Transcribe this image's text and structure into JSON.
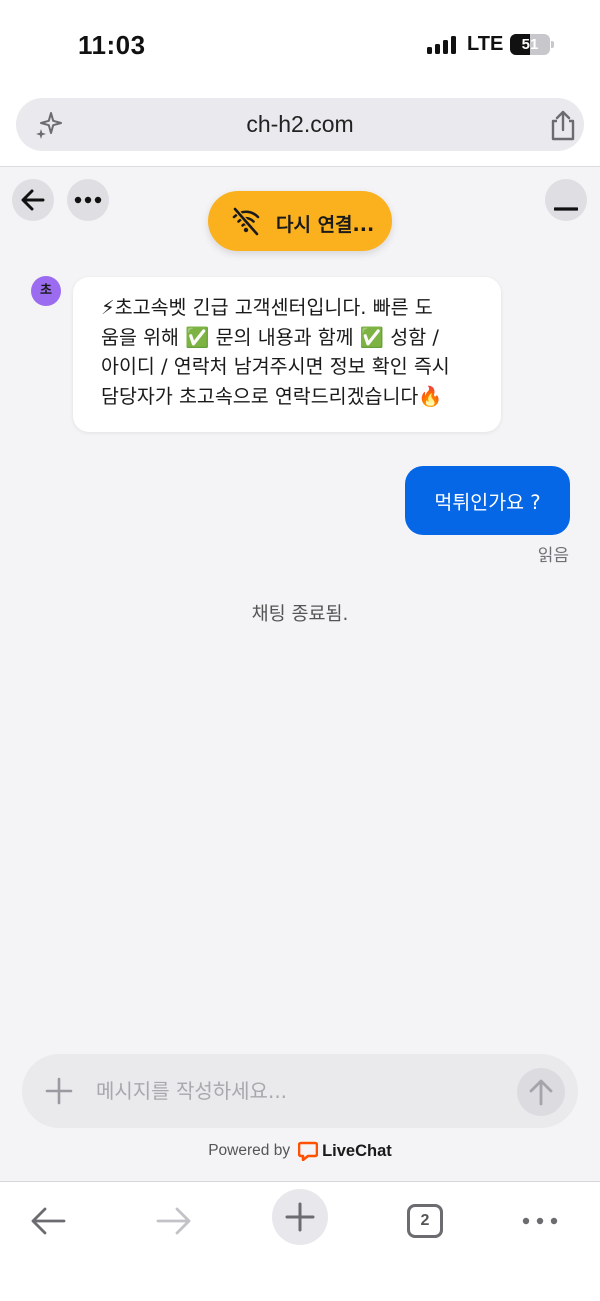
{
  "status_bar": {
    "time": "11:03",
    "network": "LTE",
    "battery": "51",
    "battery_level": 0.51
  },
  "browser": {
    "url": "ch-h2.com",
    "icons": [
      "sparkle-icon",
      "share-icon"
    ]
  },
  "chat_header": {
    "back_icon": "arrow-left-icon",
    "more_icon": "ellipsis-icon",
    "minimize_icon": "minus-icon",
    "reconnect_label": "다시 연결...",
    "reconnect_icon": "wifi-off-icon",
    "reconnect_color": "#fbb11e"
  },
  "messages": {
    "agent_avatar": "초",
    "agent_avatar_color": "#9b6cf0",
    "agent_line1": "⚡초고속벳 긴급 고객센터입니다. 빠른 도",
    "agent_line2": "움을 위해 ✅ 문의 내용과 함께 ✅ 성함 /",
    "agent_line3": "아이디 / 연락처 남겨주시면 정보 확인 즉시",
    "agent_line4": "담당자가 초고속으로 연락드리겠습니다🔥",
    "user_text": "먹튀인가요 ?",
    "user_bubble_color": "#0566e6",
    "read_receipt": "읽음",
    "chat_ended": "채팅 종료됨."
  },
  "composer": {
    "placeholder": "메시지를 작성하세요...",
    "plus_icon": "plus-icon",
    "send_icon": "arrow-up-icon"
  },
  "footer": {
    "powered_by": "Powered by",
    "brand": "LiveChat",
    "brand_color": "#ff5100"
  },
  "toolbar": {
    "tabs_count": "2",
    "icons": [
      "back-arrow-icon",
      "forward-arrow-icon",
      "new-tab-icon",
      "tabs-icon",
      "more-icon"
    ]
  }
}
